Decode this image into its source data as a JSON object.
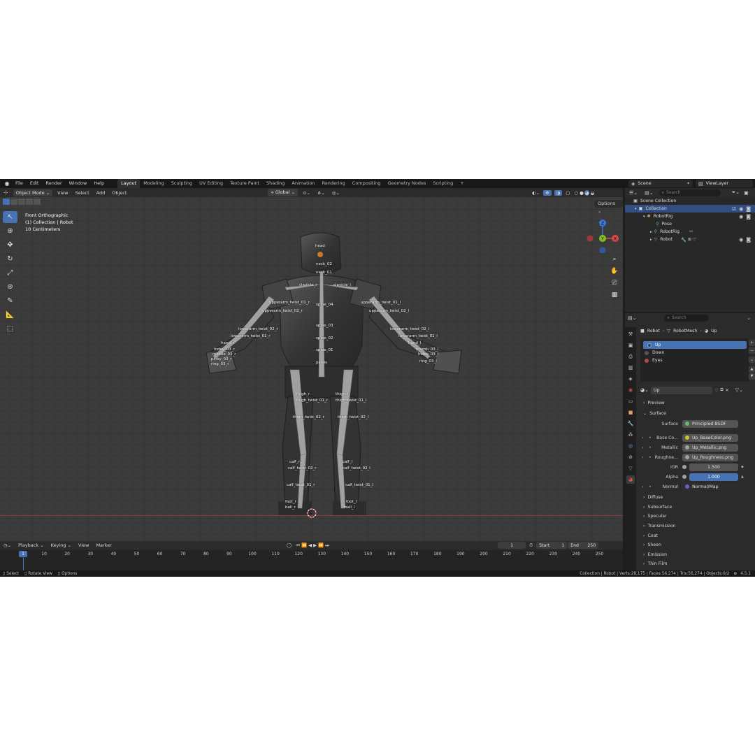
{
  "topbar": {
    "menus": [
      "File",
      "Edit",
      "Render",
      "Window",
      "Help"
    ],
    "workspaces": [
      "Layout",
      "Modeling",
      "Sculpting",
      "UV Editing",
      "Texture Paint",
      "Shading",
      "Animation",
      "Rendering",
      "Compositing",
      "Geometry Nodes",
      "Scripting"
    ],
    "active_workspace": "Layout",
    "add_tab": "+",
    "scene": "Scene",
    "view_layer": "ViewLayer"
  },
  "viewport": {
    "mode": "Object Mode",
    "menus": [
      "View",
      "Select",
      "Add",
      "Object"
    ],
    "transform_orientation": "Global",
    "options_label": "Options",
    "info": {
      "view_name": "Front Orthographic",
      "collection": "(1) Collection | Robot",
      "scale": "10 Centimeters"
    },
    "gizmo": {
      "z": "Z",
      "y": "Y",
      "x": "X"
    },
    "bone_labels": {
      "head": "head",
      "neck_02": "neck_02",
      "neck_01": "neck_01",
      "clavicle_r": "clavicle_r",
      "clavicle_l": "clavicle_l",
      "upperarm_twist_01_r": "upperarm_twist_01_r",
      "upperarm_twist_01_l": "upperarm_twist_01_l",
      "spine_04": "spine_04",
      "upperarm_twist_02_r": "upperarm_twist_02_r",
      "upperarm_twist_02_l": "upperarm_twist_02_l",
      "spine_03": "spine_03",
      "lowerarm_twist_02_r": "lowerarm_twist_02_r",
      "lowerarm_twist_02_l": "lowerarm_twist_02_l",
      "lowerarm_twist_01_r": "lowerarm_twist_01_r",
      "lowerarm_twist_01_l": "lowerarm_twist_01_l",
      "spine_02": "spine_02",
      "spine_01": "spine_01",
      "pelvis": "pelvis",
      "thigh_r": "thigh_r",
      "thigh_l": "thigh_l",
      "thigh_twist_01_r": "thigh_twist_01_r",
      "thigh_twist_01_l": "thigh_twist_01_l",
      "thigh_twist_02_r": "thigh_twist_02_r",
      "thigh_twist_02_l": "thigh_twist_02_l",
      "calf_r": "calf_r",
      "calf_l": "calf_l",
      "calf_twist_02_r": "calf_twist_02_r",
      "calf_twist_02_l": "calf_twist_02_l",
      "calf_twist_01_r": "calf_twist_01_r",
      "calf_twist_01_l": "calf_twist_01_l",
      "foot_r": "foot_r",
      "foot_l": "foot_l",
      "ball_r": "ball_r",
      "ball_l": "ball_l",
      "hand_r": "hand_r",
      "hand_l": "hand_l",
      "ring_03_r": "ring_03_r",
      "ring_03_l": "ring_03_l",
      "pinky_03_r": "pinky_03_r",
      "index_03_r": "index_03_r",
      "middle_03_r": "middle_03_r",
      "index_03_l": "index_03_l",
      "thumb_03_l": "thumb_03_l"
    }
  },
  "outliner": {
    "search_placeholder": "Search",
    "scene_collection": "Scene Collection",
    "items": [
      "Collection",
      "RobotRig",
      "Pose",
      "RobotRig",
      "Robot"
    ]
  },
  "properties": {
    "search_placeholder": "Search",
    "breadcrumb": [
      "Robot",
      "RobotMesh",
      "Up"
    ],
    "material_slots": [
      "Up",
      "Down",
      "Eyes"
    ],
    "material_name": "Up",
    "panels": {
      "preview": "Preview",
      "surface": "Surface"
    },
    "surface": {
      "surface_label": "Surface",
      "surface_value": "Principled BSDF",
      "base_color_label": "Base Co...",
      "base_color_value": "Up_BaseColor.png",
      "metallic_label": "Metallic",
      "metallic_value": "Up_Metallic.png",
      "roughness_label": "Roughne...",
      "roughness_value": "Up_Roughness.png",
      "ior_label": "IOR",
      "ior_value": "1.500",
      "alpha_label": "Alpha",
      "alpha_value": "1.000",
      "normal_label": "Normal",
      "normal_value": "Normal/Map"
    },
    "subpanels": [
      "Diffuse",
      "Subsurface",
      "Specular",
      "Transmission",
      "Coat",
      "Sheen",
      "Emission",
      "Thin Film"
    ]
  },
  "timeline": {
    "menus": [
      "Playback",
      "Keying",
      "View",
      "Marker"
    ],
    "current_frame": "1",
    "start_label": "Start",
    "start": "1",
    "end_label": "End",
    "end": "250",
    "ticks": [
      "10",
      "20",
      "30",
      "40",
      "50",
      "60",
      "70",
      "80",
      "90",
      "100",
      "110",
      "120",
      "130",
      "140",
      "150",
      "160",
      "170",
      "180",
      "190",
      "200",
      "210",
      "220",
      "230",
      "240",
      "250"
    ]
  },
  "statusbar": {
    "select": "Select",
    "rotate_view": "Rotate View",
    "options": "Options",
    "stats": "Collection | Robot | Verts:28,175 | Faces:56,274 | Tris:56,274 | Objects:0/2",
    "version": "4.5.1"
  },
  "colors": {
    "accent": "#4772b3",
    "gizmo_x": "#d44a4a",
    "gizmo_y": "#82c21e",
    "gizmo_z": "#3b7ad9"
  }
}
